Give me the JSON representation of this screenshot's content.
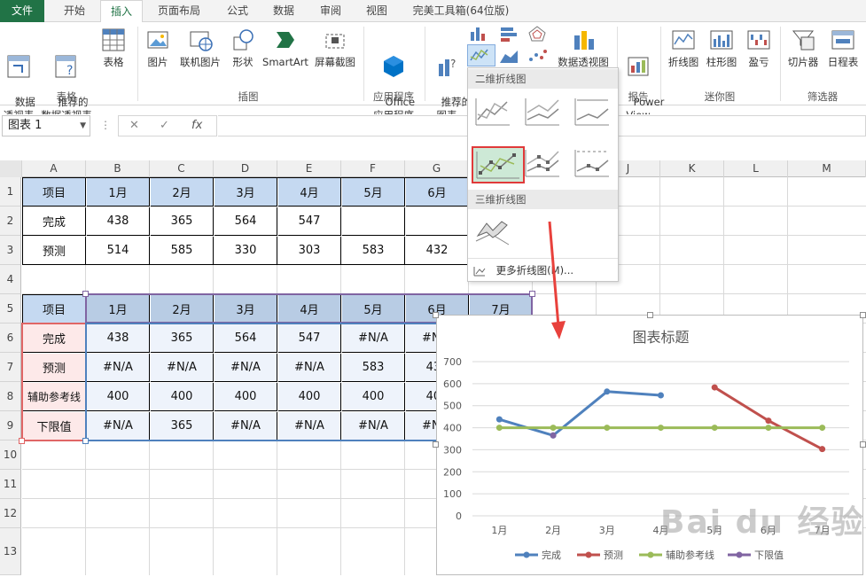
{
  "tabs": {
    "file": "文件",
    "start": "开始",
    "insert": "插入",
    "layout": "页面布局",
    "formula": "公式",
    "data": "数据",
    "review": "审阅",
    "view": "视图",
    "addin": "完美工具箱(64位版)"
  },
  "ribbon": {
    "pivot": "数据\n透视表",
    "recpivot": "推荐的\n数据透视表",
    "table": "表格",
    "g_table": "表格",
    "pic": "图片",
    "onlinepic": "联机图片",
    "shape": "形状",
    "smartart": "SmartArt",
    "screenshot": "屏幕截图",
    "g_illus": "插图",
    "office": "Office\n应用程序",
    "g_apps": "应用程序",
    "recchart": "推荐的\n图表",
    "pivotchart": "数据透视图",
    "powerview": "Power\nView",
    "g_report": "报告",
    "spark_line": "折线图",
    "spark_col": "柱形图",
    "spark_wl": "盈亏",
    "g_spark": "迷你图",
    "slicer": "切片器",
    "timeline": "日程表",
    "g_filter": "筛选器"
  },
  "namebox": "图表 1",
  "fx": "fx",
  "columns": [
    "A",
    "B",
    "C",
    "D",
    "E",
    "F",
    "G",
    "H",
    "I",
    "J",
    "K",
    "L",
    "M"
  ],
  "rows": [
    "1",
    "2",
    "3",
    "4",
    "5",
    "6",
    "7",
    "8",
    "9",
    "10",
    "11",
    "12",
    "13"
  ],
  "table1": {
    "header": [
      "项目",
      "1月",
      "2月",
      "3月",
      "4月",
      "5月",
      "6月"
    ],
    "r1": [
      "完成",
      "438",
      "365",
      "564",
      "547",
      "",
      ""
    ],
    "r2": [
      "预测",
      "514",
      "585",
      "330",
      "303",
      "583",
      "432"
    ]
  },
  "table2": {
    "header": [
      "项目",
      "1月",
      "2月",
      "3月",
      "4月",
      "5月",
      "6月",
      "7月"
    ],
    "r1": [
      "完成",
      "438",
      "365",
      "564",
      "547",
      "#N/A",
      "#N/A"
    ],
    "r2": [
      "预测",
      "#N/A",
      "#N/A",
      "#N/A",
      "#N/A",
      "583",
      "432"
    ],
    "r3": [
      "辅助参考线",
      "400",
      "400",
      "400",
      "400",
      "400",
      "400"
    ],
    "r4": [
      "下限值",
      "#N/A",
      "365",
      "#N/A",
      "#N/A",
      "#N/A",
      "#N/A"
    ]
  },
  "menu": {
    "sec2d": "二维折线图",
    "sec3d": "三维折线图",
    "more": "更多折线图(M)..."
  },
  "chart_data": {
    "type": "line",
    "title": "图表标题",
    "categories": [
      "1月",
      "2月",
      "3月",
      "4月",
      "5月",
      "6月",
      "7月"
    ],
    "ylim": [
      0,
      700
    ],
    "yticks": [
      "700",
      "600",
      "500",
      "400",
      "300",
      "200",
      "100",
      "0"
    ],
    "series": [
      {
        "name": "完成",
        "color": "#4f81bd",
        "values": [
          438,
          365,
          564,
          547,
          null,
          null,
          null
        ]
      },
      {
        "name": "预测",
        "color": "#c0504d",
        "values": [
          null,
          null,
          null,
          null,
          583,
          432,
          303
        ]
      },
      {
        "name": "辅助参考线",
        "color": "#9bbb59",
        "values": [
          400,
          400,
          400,
          400,
          400,
          400,
          400
        ]
      },
      {
        "name": "下限值",
        "color": "#8064a2",
        "values": [
          null,
          365,
          null,
          null,
          null,
          null,
          null
        ]
      }
    ],
    "legend": "bottom",
    "grid": true
  },
  "watermark": "Bai du 经验"
}
